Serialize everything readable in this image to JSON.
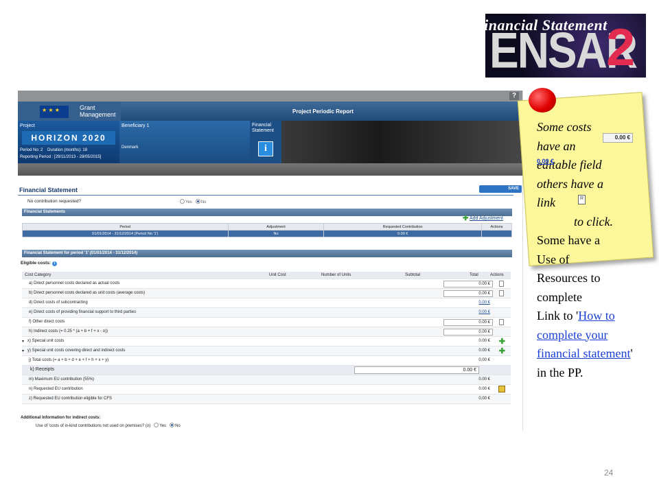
{
  "slide": {
    "title": "Financial Statement",
    "page_number": "24"
  },
  "logo": {
    "text": "ENSAR",
    "number": "2"
  },
  "app": {
    "help_label": "?",
    "grant_label_1": "Grant",
    "grant_label_2": "Management",
    "report_title": "Project Periodic Report",
    "project_label": "Project",
    "horizon_text": "HORIZON 2020",
    "period_no": "Period No: 2",
    "duration": "Duration (months): 18",
    "reporting_period": "Reporting Period : [29/11/2013 - 28/05/2015]",
    "beneficiary_label": "Beneficiary 1",
    "country": "Denmark",
    "fs_label_1": "Financial",
    "fs_label_2": "Statement",
    "info_icon": "i",
    "fs_heading": "Financial Statement",
    "save_label": "SAVE",
    "no_contribution": "No contribution requested?",
    "yes": "Yes",
    "no": "No",
    "statements_bar": "Financial Statements",
    "add_adjustment": "Add Adjustment",
    "statements_table": {
      "headers": [
        "Period",
        "Adjustment",
        "Requested Contribution",
        "Actions"
      ],
      "row": [
        "01/01/2014 - 31/12/2014 (Period No '1')",
        "No",
        "0.00 €",
        ""
      ]
    },
    "period_bar": "Financial Statement for period '1' (01/01/2014 - 31/12/2014)",
    "eligible_costs": "Eligible costs:",
    "cost_headers": [
      "Cost Category",
      "Unit Cost",
      "Number of Units",
      "Subtotal",
      "Total",
      "Actions"
    ],
    "costs": [
      {
        "label": "a) Direct personnel costs declared as actual costs",
        "total": "0.00 €",
        "kind": "box",
        "action": "doc"
      },
      {
        "label": "b) Direct personnel costs declared as unit costs (average costs)",
        "total": "0.00 €",
        "kind": "box",
        "action": "doc"
      },
      {
        "label": "d) Direct costs of subcontracting",
        "total": "0.00 €",
        "kind": "link",
        "action": ""
      },
      {
        "label": "e) Direct costs of providing financial support to third parties",
        "total": "0.00 €",
        "kind": "link",
        "action": ""
      },
      {
        "label": "f) Other direct costs",
        "total": "0.00 €",
        "kind": "box",
        "action": "doc"
      },
      {
        "label": "h) Indirect costs (= 0.25 * (a + b + f + x - o))",
        "total": "0.00 €",
        "kind": "box",
        "action": ""
      },
      {
        "label": "x) Special unit costs",
        "total": "0.00 €",
        "kind": "text",
        "action": "plus"
      },
      {
        "label": "y) Special unit costs covering direct and indirect costs",
        "total": "0.00 €",
        "kind": "text",
        "action": "plus"
      },
      {
        "label": "j) Total costs (= a + b + d + e + f + h + x + y)",
        "total": "0.00 €",
        "kind": "text",
        "action": ""
      }
    ],
    "receipts": {
      "label": "k) Receipts",
      "value": "0.00 €"
    },
    "contributions": [
      {
        "label": "m) Maximum EU contribution (55%)",
        "total": "0.00 €",
        "action": ""
      },
      {
        "label": "n) Requested EU contribution",
        "total": "0.00 €",
        "action": "edit"
      },
      {
        "label": "z) Requested EU contribution eligible for CFS",
        "total": "0.00 €",
        "action": ""
      }
    ],
    "additional_info": "Additional Information for indirect costs:",
    "use_of_costs": "Use of 'costs of in-kind contributions not used on premises? (o)"
  },
  "note": {
    "line_1": "Some costs",
    "line_2": "have an",
    "line_3": "editable field",
    "line_4": "others have a",
    "line_5": "link",
    "line_6": "to click.",
    "value_box": "0.00 €",
    "value_link": "0.00 €"
  },
  "callout": {
    "line_1": "Some have a",
    "line_2": "Use of",
    "line_3": "Resources to",
    "line_4": "complete",
    "link_prefix": "Link to '",
    "link_text": "How to complete your financial statement",
    "link_suffix": "' in the PP."
  }
}
